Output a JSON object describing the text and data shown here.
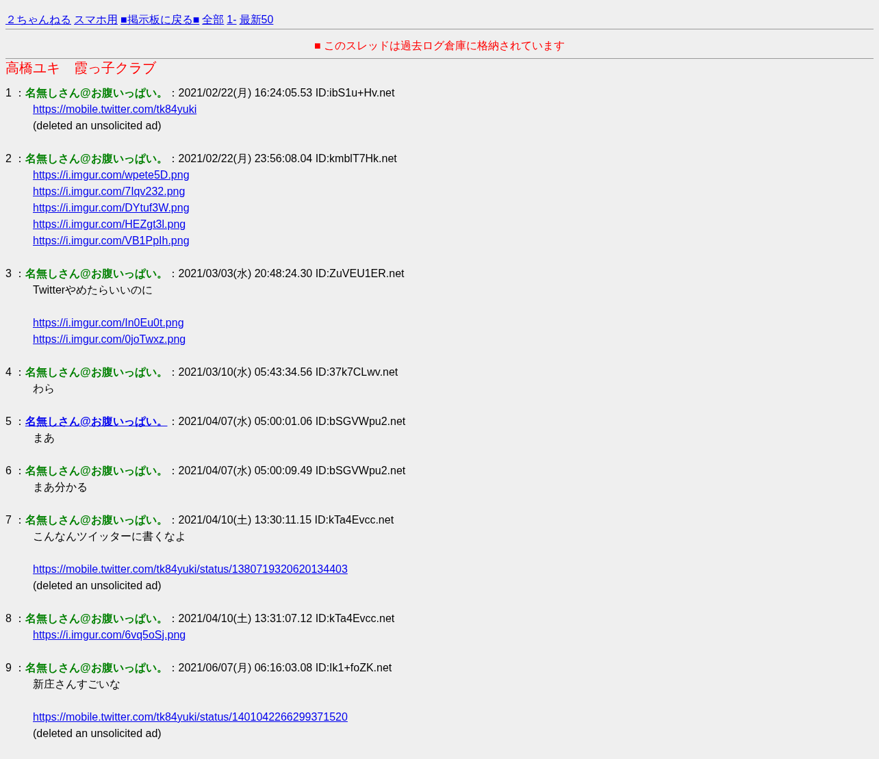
{
  "nav": [
    {
      "text": "２ちゃんねる"
    },
    {
      "text": "スマホ用"
    },
    {
      "text": "■掲示板に戻る■"
    },
    {
      "text": "全部"
    },
    {
      "text": "1-"
    },
    {
      "text": "最新50"
    }
  ],
  "notice": "■ このスレッドは過去ログ倉庫に格納されています",
  "thread_title": "高橋ユキ　霞っ子クラブ",
  "posts": [
    {
      "number": "1",
      "separator": "：",
      "name": "名無しさん@お腹いっぱい。",
      "name_link": false,
      "meta": "：2021/02/22(月) 16:24:05.53 ID:ibS1u+Hv.net",
      "lines": [
        {
          "kind": "link",
          "text": "https://mobile.twitter.com/tk84yuki"
        },
        {
          "kind": "text",
          "text": "(deleted an unsolicited ad)"
        }
      ]
    },
    {
      "number": "2",
      "separator": "：",
      "name": "名無しさん@お腹いっぱい。",
      "name_link": false,
      "meta": "：2021/02/22(月) 23:56:08.04 ID:kmblT7Hk.net",
      "lines": [
        {
          "kind": "link",
          "text": "https://i.imgur.com/wpete5D.png"
        },
        {
          "kind": "link",
          "text": "https://i.imgur.com/7Iqv232.png"
        },
        {
          "kind": "link",
          "text": "https://i.imgur.com/DYtuf3W.png"
        },
        {
          "kind": "link",
          "text": "https://i.imgur.com/HEZgt3l.png"
        },
        {
          "kind": "link",
          "text": "https://i.imgur.com/VB1PpIh.png"
        }
      ]
    },
    {
      "number": "3",
      "separator": "：",
      "name": "名無しさん@お腹いっぱい。",
      "name_link": false,
      "meta": "：2021/03/03(水) 20:48:24.30 ID:ZuVEU1ER.net",
      "lines": [
        {
          "kind": "text",
          "text": "Twitterやめたらいいのに"
        },
        {
          "kind": "break"
        },
        {
          "kind": "link",
          "text": "https://i.imgur.com/In0Eu0t.png"
        },
        {
          "kind": "link",
          "text": "https://i.imgur.com/0joTwxz.png"
        }
      ]
    },
    {
      "number": "4",
      "separator": "：",
      "name": "名無しさん@お腹いっぱい。",
      "name_link": false,
      "meta": "：2021/03/10(水) 05:43:34.56 ID:37k7CLwv.net",
      "lines": [
        {
          "kind": "text",
          "text": "わら"
        }
      ]
    },
    {
      "number": "5",
      "separator": "：",
      "name": "名無しさん@お腹いっぱい。",
      "name_link": true,
      "meta": "：2021/04/07(水) 05:00:01.06 ID:bSGVWpu2.net",
      "lines": [
        {
          "kind": "text",
          "text": "まあ"
        }
      ]
    },
    {
      "number": "6",
      "separator": "：",
      "name": "名無しさん@お腹いっぱい。",
      "name_link": false,
      "meta": "：2021/04/07(水) 05:00:09.49 ID:bSGVWpu2.net",
      "lines": [
        {
          "kind": "text",
          "text": "まあ分かる"
        }
      ]
    },
    {
      "number": "7",
      "separator": "：",
      "name": "名無しさん@お腹いっぱい。",
      "name_link": false,
      "meta": "：2021/04/10(土) 13:30:11.15 ID:kTa4Evcc.net",
      "lines": [
        {
          "kind": "text",
          "text": "こんなんツイッターに書くなよ"
        },
        {
          "kind": "break"
        },
        {
          "kind": "link",
          "text": "https://mobile.twitter.com/tk84yuki/status/1380719320620134403"
        },
        {
          "kind": "text",
          "text": "(deleted an unsolicited ad)"
        }
      ]
    },
    {
      "number": "8",
      "separator": "：",
      "name": "名無しさん@お腹いっぱい。",
      "name_link": false,
      "meta": "：2021/04/10(土) 13:31:07.12 ID:kTa4Evcc.net",
      "lines": [
        {
          "kind": "link",
          "text": "https://i.imgur.com/6vq5oSj.png"
        }
      ]
    },
    {
      "number": "9",
      "separator": "：",
      "name": "名無しさん@お腹いっぱい。",
      "name_link": false,
      "meta": "：2021/06/07(月) 06:16:03.08 ID:Ik1+foZK.net",
      "lines": [
        {
          "kind": "text",
          "text": "新庄さんすごいな"
        },
        {
          "kind": "break"
        },
        {
          "kind": "link",
          "text": "https://mobile.twitter.com/tk84yuki/status/1401042266299371520"
        },
        {
          "kind": "text",
          "text": "(deleted an unsolicited ad)"
        }
      ]
    }
  ]
}
